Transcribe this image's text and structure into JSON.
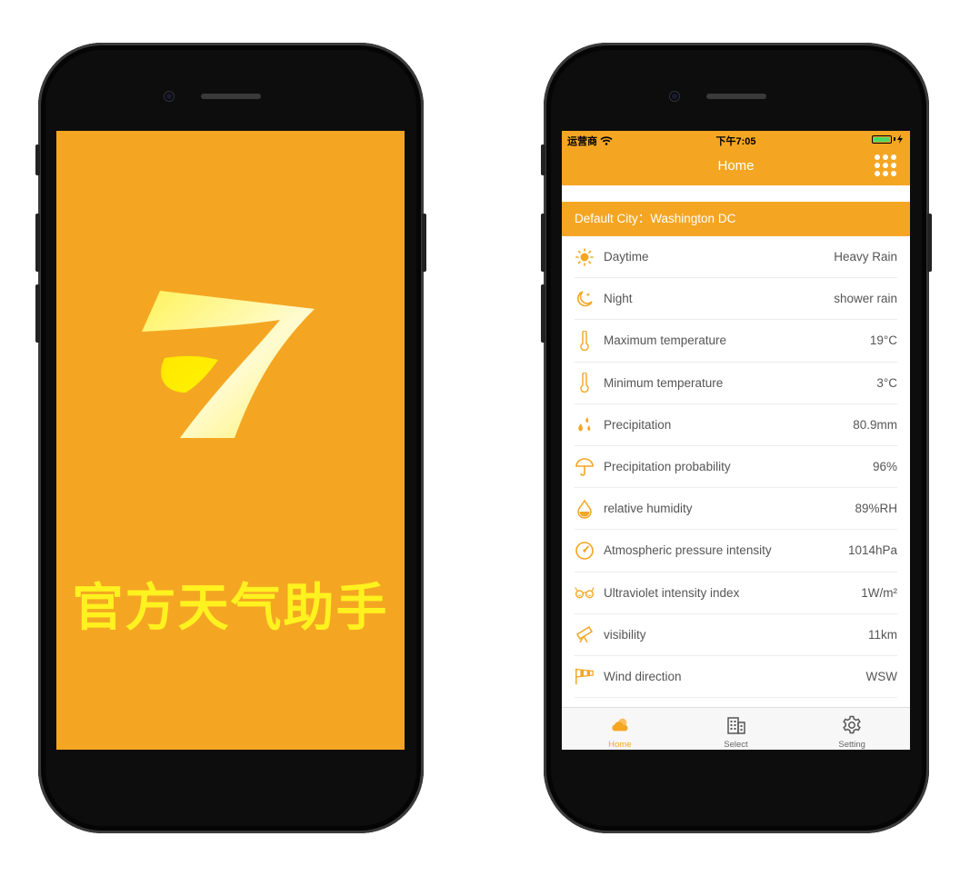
{
  "splash": {
    "title": "官方天气助手",
    "logo_icon": "seven-logo-icon",
    "background": "#f4a623",
    "title_color": "#fff21f"
  },
  "app": {
    "status_bar": {
      "carrier": "运营商",
      "time": "下午7:05",
      "icons": [
        "wifi-icon",
        "battery-icon",
        "charging-icon"
      ]
    },
    "nav": {
      "title": "Home",
      "menu_icon": "grid-menu-icon"
    },
    "default_city": "Default City：Washington DC",
    "accent": "#f4a623",
    "rows": [
      {
        "label": "Daytime",
        "value": "Heavy Rain",
        "icon": "sun-icon"
      },
      {
        "label": "Night",
        "value": "shower rain",
        "icon": "moon-icon"
      },
      {
        "label": "Maximum temperature",
        "value": "19°C",
        "icon": "thermometer-icon"
      },
      {
        "label": "Minimum temperature",
        "value": "3°C",
        "icon": "thermometer-icon"
      },
      {
        "label": "Precipitation",
        "value": "80.9mm",
        "icon": "raindrops-icon"
      },
      {
        "label": "Precipitation probability",
        "value": "96%",
        "icon": "umbrella-icon"
      },
      {
        "label": "relative humidity",
        "value": "89%RH",
        "icon": "humidity-drop-icon"
      },
      {
        "label": "Atmospheric pressure intensity",
        "value": "1014hPa",
        "icon": "gauge-icon"
      },
      {
        "label": "Ultraviolet intensity index",
        "value": "1W/m²",
        "icon": "sunglasses-icon"
      },
      {
        "label": "visibility",
        "value": "11km",
        "icon": "telescope-icon"
      },
      {
        "label": "Wind direction",
        "value": "WSW",
        "icon": "windsock-icon"
      }
    ],
    "tabs": [
      {
        "label": "Home",
        "icon": "cloud-sun-icon",
        "active": true
      },
      {
        "label": "Select",
        "icon": "building-icon",
        "active": false
      },
      {
        "label": "Setting",
        "icon": "gear-icon",
        "active": false
      }
    ]
  }
}
